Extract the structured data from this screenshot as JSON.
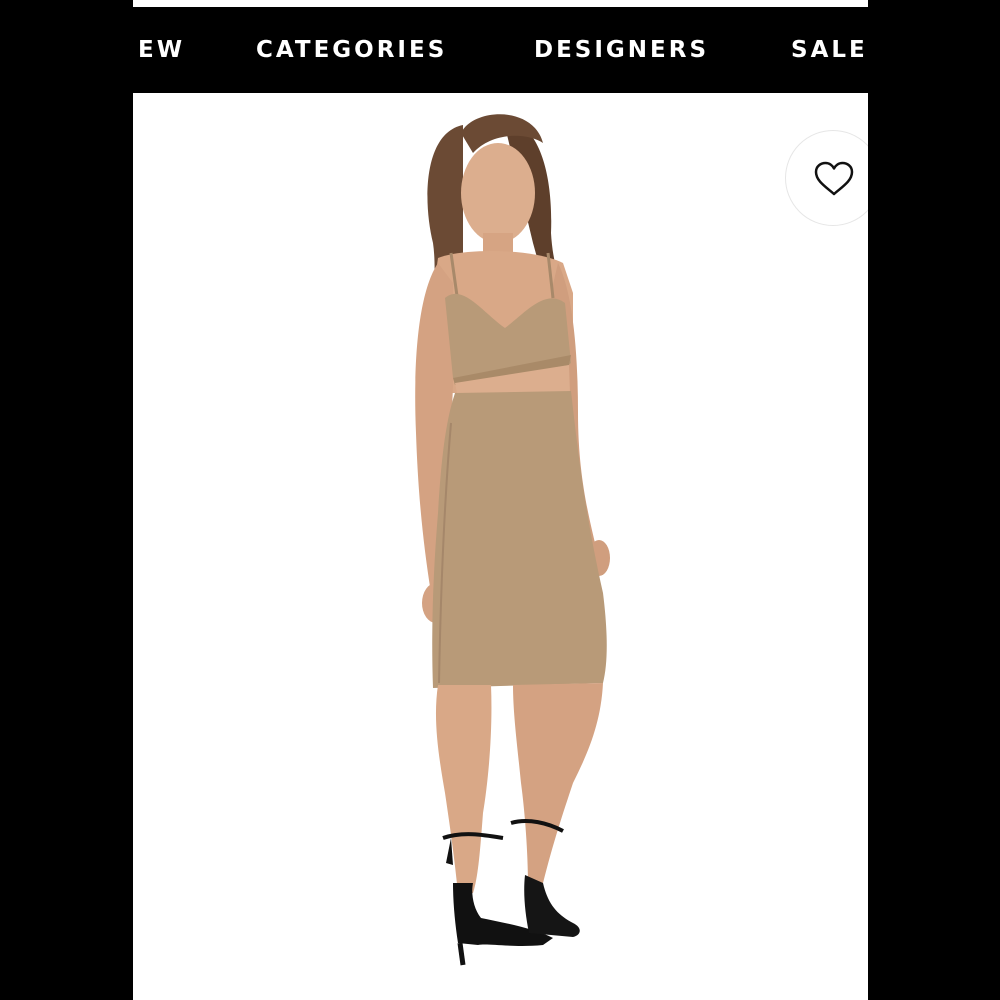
{
  "navigation": {
    "items": [
      {
        "label": "EW"
      },
      {
        "label": "CATEGORIES"
      },
      {
        "label": "DESIGNERS"
      },
      {
        "label": "SALE"
      }
    ]
  },
  "product_image": {
    "subject": "model-in-tan-cutout-midi-dress",
    "colors": {
      "dress": "#b89a78",
      "skin": "#d9a887",
      "hair": "#6b4a34",
      "shoes": "#111111"
    }
  },
  "favorite": {
    "icon": "heart-outline-icon"
  },
  "colors": {
    "background": "#000000",
    "nav_background": "#000000",
    "nav_text": "#ffffff",
    "content_background": "#ffffff"
  }
}
